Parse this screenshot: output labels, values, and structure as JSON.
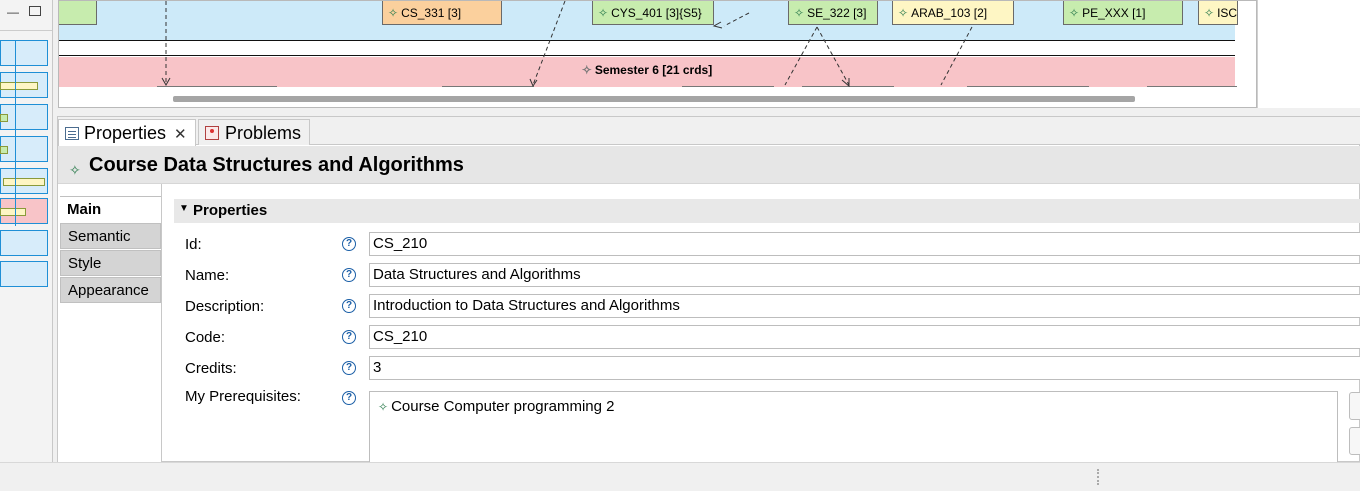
{
  "diagram": {
    "courses": [
      {
        "label": "CS_331 [3]",
        "color": "orange"
      },
      {
        "label": "CYS_401 [3]{S5}",
        "color": "green"
      },
      {
        "label": "SE_322 [3]",
        "color": "green"
      },
      {
        "label": "ARAB_103 [2]",
        "color": "yellow"
      },
      {
        "label": "PE_XXX [1]",
        "color": "green"
      },
      {
        "label": "ISC",
        "color": "yellow"
      }
    ],
    "semester6_label": "Semester 6 [21 crds]"
  },
  "tabs": {
    "properties": "Properties",
    "problems": "Problems"
  },
  "header": {
    "title": "Course Data Structures and Algorithms"
  },
  "side_tabs": [
    "Main",
    "Semantic",
    "Style",
    "Appearance"
  ],
  "section": {
    "title": "Properties"
  },
  "fields": {
    "id": {
      "label": "Id:",
      "value": "CS_210"
    },
    "name": {
      "label": "Name:",
      "value": "Data Structures and Algorithms"
    },
    "description": {
      "label": "Description:",
      "value": "Introduction to Data Structures and Algorithms"
    },
    "code": {
      "label": "Code:",
      "value": "CS_210"
    },
    "credits": {
      "label": "Credits:",
      "value": "3"
    },
    "prerequisites": {
      "label": "My Prerequisites:",
      "items": [
        "Course Computer programming 2"
      ]
    }
  },
  "colors": {
    "semester5_bg": "#cdeaf9",
    "semester6_bg": "#f8c4c8",
    "course_green": "#c7ecae",
    "course_orange": "#fbd09d",
    "course_yellow": "#fef6c4",
    "help_blue": "#1b5fa7"
  },
  "icons": {
    "course": "sparkle-icon",
    "help": "help-icon",
    "properties_tab": "properties-view-icon",
    "problems_tab": "problems-view-icon"
  }
}
